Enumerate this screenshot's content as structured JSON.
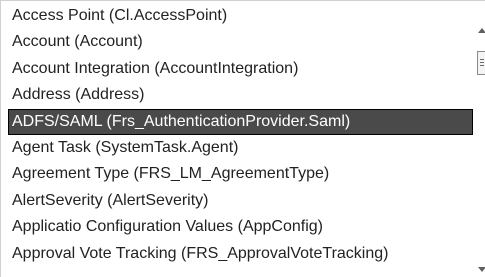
{
  "list": {
    "items": [
      {
        "label": "Access Point (Cl.AccessPoint)"
      },
      {
        "label": "Account (Account)"
      },
      {
        "label": "Account Integration (AccountIntegration)"
      },
      {
        "label": "Address (Address)"
      },
      {
        "label": "ADFS/SAML (Frs_AuthenticationProvider.Saml)",
        "selected": true
      },
      {
        "label": "Agent Task (SystemTask.Agent)"
      },
      {
        "label": "Agreement Type (FRS_LM_AgreementType)"
      },
      {
        "label": "AlertSeverity (AlertSeverity)"
      },
      {
        "label": "Applicatio Configuration Values (AppConfig)"
      },
      {
        "label": "Approval Vote Tracking (FRS_ApprovalVoteTracking)"
      }
    ],
    "selected_index": 4
  },
  "scrollbar": {
    "up_icon": "arrow-up-icon",
    "down_icon": "arrow-down-icon",
    "thumb_icon": "grip-icon"
  },
  "colors": {
    "selected_background": "#4a4a4a",
    "selected_text": "#ffffff",
    "text": "#222222"
  }
}
